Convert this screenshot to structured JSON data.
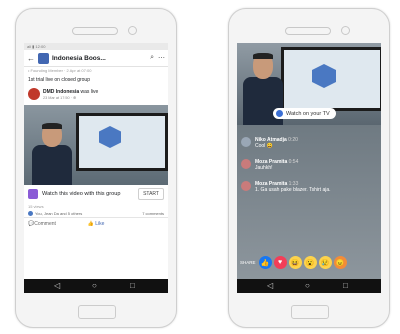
{
  "left_phone": {
    "status_text": "all ▮ 12:00",
    "group_title": "Indonesia Boos...",
    "faded_line": "• Founding Member · 2 Apr at 07:00",
    "post_text": "1st trial live on closed group",
    "post_author": "DMD Indonesia",
    "post_action": "was live",
    "post_time": "23 Mar at 17:50 · ⊕",
    "watch_text": "Watch this video with this group",
    "start_label": "START",
    "views": "15 views",
    "reactions_text": "You, Jean Da and 5 others",
    "comments_count": "7 comments",
    "like_label": "Like",
    "comment_label": "Comment"
  },
  "right_phone": {
    "tv_button": "Watch on your TV",
    "comments": [
      {
        "name": "Niko Atmadja",
        "time": "0:20",
        "text": "Cool 😄"
      },
      {
        "name": "Moza Pramita",
        "time": "0:54",
        "text": "Jauhkh!"
      },
      {
        "name": "Moza Pramita",
        "time": "1:33",
        "text": "1. Ga usah pake blazer. Tshirt aja."
      }
    ],
    "share_label": "SHARE"
  },
  "colors": {
    "brand": "#4267b2",
    "watch_icon": "#8a5bd6",
    "like": "#1877f2",
    "love": "#f33e58"
  }
}
